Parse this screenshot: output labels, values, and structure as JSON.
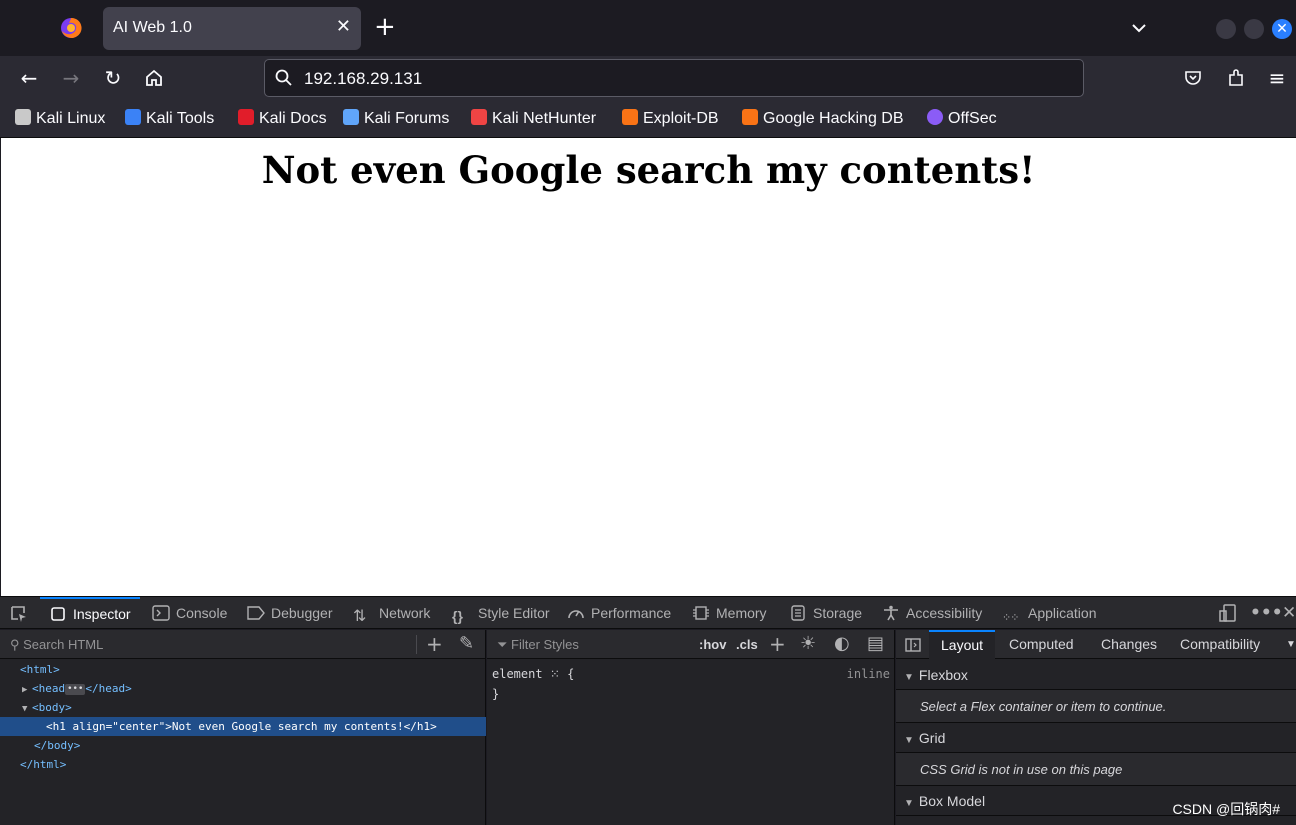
{
  "tab": {
    "title": "AI Web 1.0",
    "close": "✕",
    "new_tab": "+"
  },
  "navbar": {
    "url": "192.168.29.131"
  },
  "bookmarks": [
    {
      "label": "Kali Linux",
      "icon": "kali-dragon-icon",
      "color": "#c9c9c9"
    },
    {
      "label": "Kali Tools",
      "icon": "kali-tools-icon",
      "color": "#3b82f6"
    },
    {
      "label": "Kali Docs",
      "icon": "kali-docs-icon",
      "color": "#e11d2a"
    },
    {
      "label": "Kali Forums",
      "icon": "kali-forums-icon",
      "color": "#60a5fa"
    },
    {
      "label": "Kali NetHunter",
      "icon": "kali-nethunter-icon",
      "color": "#ef4444"
    },
    {
      "label": "Exploit-DB",
      "icon": "exploit-db-icon",
      "color": "#f97316"
    },
    {
      "label": "Google Hacking DB",
      "icon": "ghdb-icon",
      "color": "#f97316"
    },
    {
      "label": "OffSec",
      "icon": "offsec-icon",
      "color": "#8b5cf6"
    }
  ],
  "page": {
    "heading": "Not even Google search my contents!"
  },
  "devtools": {
    "tabs": [
      "Inspector",
      "Console",
      "Debugger",
      "Network",
      "Style Editor",
      "Performance",
      "Memory",
      "Storage",
      "Accessibility",
      "Application"
    ],
    "search_html_placeholder": "Search HTML",
    "filter_styles_placeholder": "Filter Styles",
    "hov": ":hov",
    "cls": ".cls",
    "markup": {
      "html_open": "<html",
      "html_open_end": ">",
      "head_open": "<head",
      "head_close": "</head>",
      "body_open": "<body",
      "body_open_end": ">",
      "h1_open": "<h1",
      "h1_attr": " align",
      "h1_eq": "=",
      "h1_val": "\"center\"",
      "h1_text": "Not even Google search my contents!",
      "h1_close": "</h1>",
      "body_close": "</body>",
      "html_close": "</html>"
    },
    "rules": {
      "selector": "element",
      "open": "{",
      "close": "}",
      "inline": "inline"
    },
    "layout_tabs": [
      "Layout",
      "Computed",
      "Changes",
      "Compatibility"
    ],
    "sections": {
      "flexbox": "Flexbox",
      "flexbox_msg": "Select a Flex container or item to continue.",
      "grid": "Grid",
      "grid_msg": "CSS Grid is not in use on this page",
      "box_model": "Box Model"
    }
  },
  "watermark": "CSDN @回锅肉#"
}
